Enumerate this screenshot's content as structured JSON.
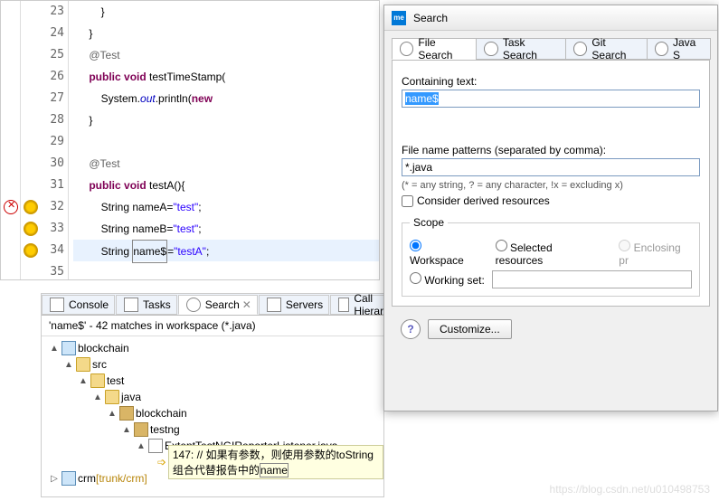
{
  "editor": {
    "lines": [
      {
        "n": "23",
        "code": "        }",
        "markerA": "",
        "markerB": ""
      },
      {
        "n": "24",
        "code": "    }",
        "markerA": "",
        "markerB": ""
      },
      {
        "n": "25",
        "code": "    @Test",
        "ann": true,
        "markerA": "",
        "markerB": ""
      },
      {
        "n": "26",
        "code": "    public void testTimeStamp(",
        "kw": [
          "public",
          "void"
        ],
        "markerA": "",
        "markerB": ""
      },
      {
        "n": "27",
        "code": "        System.out.println(new",
        "kw": [
          "new"
        ],
        "it": [
          "out"
        ],
        "markerA": "",
        "markerB": ""
      },
      {
        "n": "28",
        "code": "    }",
        "markerA": "",
        "markerB": ""
      },
      {
        "n": "29",
        "code": "",
        "markerA": "",
        "markerB": ""
      },
      {
        "n": "30",
        "code": "    @Test",
        "ann": true,
        "markerA": "",
        "markerB": ""
      },
      {
        "n": "31",
        "code": "    public void testA(){",
        "kw": [
          "public",
          "void"
        ],
        "markerA": "",
        "markerB": ""
      },
      {
        "n": "32",
        "code": "        String nameA=\"test\";",
        "str": "\"test\"",
        "markerA": "err",
        "markerB": "warn"
      },
      {
        "n": "33",
        "code": "        String nameB=\"test\";",
        "str": "\"test\"",
        "markerA": "",
        "markerB": "warn"
      },
      {
        "n": "34",
        "code": "        String name$=\"testA\";",
        "str": "\"testA\"",
        "hl": true,
        "boxed": "name$",
        "markerA": "",
        "markerB": "warn"
      },
      {
        "n": "35",
        "code": "",
        "markerA": "",
        "markerB": ""
      }
    ]
  },
  "bottom": {
    "tabs": [
      {
        "label": "Console",
        "icon": "console"
      },
      {
        "label": "Tasks",
        "icon": "tasks"
      },
      {
        "label": "Search",
        "icon": "search",
        "active": true,
        "closable": true
      },
      {
        "label": "Servers",
        "icon": "servers"
      },
      {
        "label": "Call Hierarchy",
        "icon": "hierarchy"
      }
    ],
    "status": "'name$' - 42 matches in workspace (*.java)",
    "tree": [
      {
        "indent": 0,
        "arrow": "▲",
        "icon": "proj",
        "label": "blockchain"
      },
      {
        "indent": 1,
        "arrow": "▲",
        "icon": "srcfolder",
        "label": "src"
      },
      {
        "indent": 2,
        "arrow": "▲",
        "icon": "folder",
        "label": "test"
      },
      {
        "indent": 3,
        "arrow": "▲",
        "icon": "folder",
        "label": "java"
      },
      {
        "indent": 4,
        "arrow": "▲",
        "icon": "pkg",
        "label": "blockchain"
      },
      {
        "indent": 5,
        "arrow": "▲",
        "icon": "pkg",
        "label": "testng"
      },
      {
        "indent": 6,
        "arrow": "▲",
        "icon": "jfile",
        "label": "ExtentTestNGIReporterListener.java"
      },
      {
        "indent": 7,
        "arrow": "",
        "icon": "match",
        "label": "147: // 如果有参数，则使用参数的toString组合代替报告中的name",
        "match": true
      }
    ],
    "crm_row": {
      "arrow": "▷",
      "icon": "proj",
      "label": "crm",
      "suffix": "[trunk/crm]"
    }
  },
  "dialog": {
    "title": "Search",
    "icon_text": "me",
    "tabs": [
      {
        "label": "File Search",
        "active": true
      },
      {
        "label": "Task Search"
      },
      {
        "label": "Git Search"
      },
      {
        "label": "Java S"
      }
    ],
    "containing_label": "Containing text:",
    "containing_value": "name$",
    "patterns_label": "File name patterns (separated by comma):",
    "patterns_value": "*.java",
    "wildcards_hint": "(* = any string, ? = any character, !x = excluding x)",
    "derived_label": "Consider derived resources",
    "scope_legend": "Scope",
    "scope": {
      "workspace": "Workspace",
      "selected": "Selected resources",
      "enclosing": "Enclosing pr",
      "working_set": "Working set:"
    },
    "customize": "Customize...",
    "help": "?"
  },
  "watermark": "https://blog.csdn.net/u010498753"
}
